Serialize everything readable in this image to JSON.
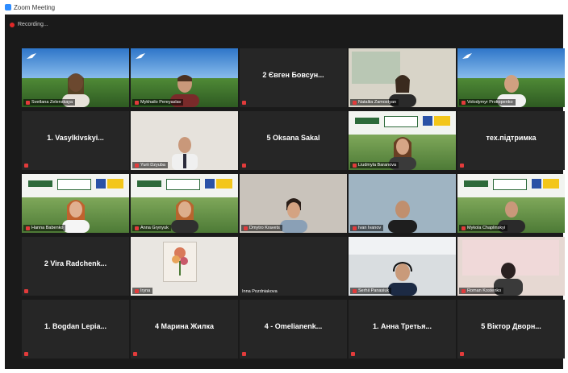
{
  "window": {
    "title": "Zoom Meeting"
  },
  "recording": {
    "label": "Recording..."
  },
  "colors": {
    "background": "#1a1a1a",
    "tile": "#262626",
    "mic_muted": "#e23b3b",
    "active_speaker": "#d5e34a",
    "recording": "#e02828"
  },
  "tiles": [
    {
      "type": "video",
      "label": "Svetlana Zelenskaya"
    },
    {
      "type": "video",
      "label": "Mykhailo Pereyaslav"
    },
    {
      "type": "name",
      "name": "2 Євген Бовсун..."
    },
    {
      "type": "video",
      "label": "Nataliia Zamostyan"
    },
    {
      "type": "video",
      "label": "Volodymyr Prokopenko"
    },
    {
      "type": "name",
      "name": "1. Vasylkivskyi..."
    },
    {
      "type": "video",
      "label": "Yurii Dzyuba"
    },
    {
      "type": "name",
      "name": "5 Oksana Sakal"
    },
    {
      "type": "video",
      "label": "Liudmyla Baranova"
    },
    {
      "type": "name",
      "name": "тех.підтримка"
    },
    {
      "type": "video",
      "label": "Hanna Babenko"
    },
    {
      "type": "video",
      "label": "Anna Grynyuk"
    },
    {
      "type": "video",
      "label": "Dmytro Kravets"
    },
    {
      "type": "video",
      "label": "Ivan Ivanov"
    },
    {
      "type": "video",
      "label": "Mykola Chaplinskyi"
    },
    {
      "type": "name",
      "name": "2 Vira Radchenk..."
    },
    {
      "type": "video",
      "label": "Iryna"
    },
    {
      "type": "name-plain",
      "label": "Inna Pozdniakova"
    },
    {
      "type": "video",
      "label": "Serhii Panasiuk"
    },
    {
      "type": "video",
      "label": "Roman Kostenko"
    },
    {
      "type": "name",
      "name": "1. Bogdan Lepia..."
    },
    {
      "type": "name",
      "name": "4 Марина Жилка"
    },
    {
      "type": "name",
      "name": "4 - Omelianenk..."
    },
    {
      "type": "name",
      "name": "1. Анна Третья..."
    },
    {
      "type": "name",
      "name": "5 Віктор Дворн..."
    }
  ]
}
